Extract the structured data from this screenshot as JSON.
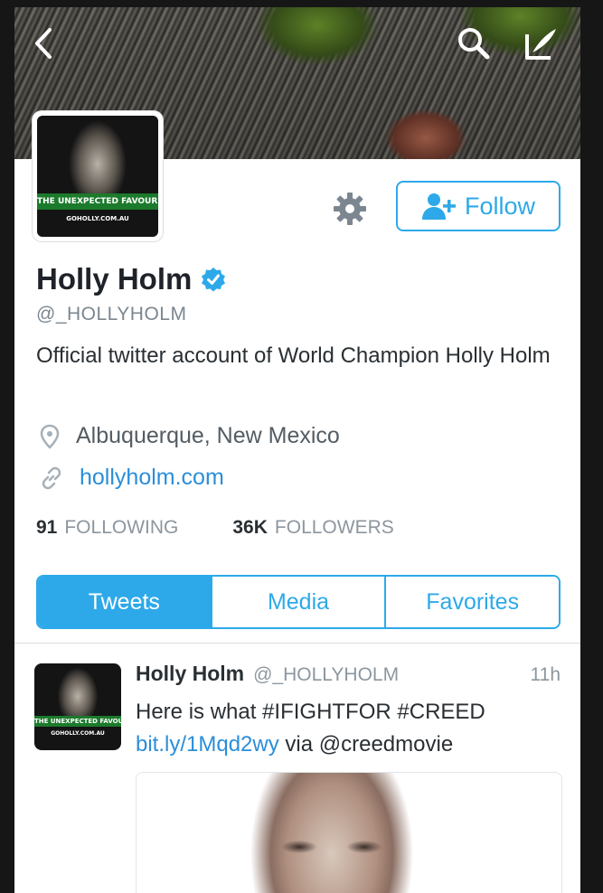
{
  "icons": {
    "back": "chevron-left-icon",
    "search": "search-icon",
    "compose": "compose-icon",
    "settings": "gear-icon",
    "follow": "add-person-icon",
    "verified": "verified-badge-icon",
    "location": "location-pin-icon",
    "link": "link-icon"
  },
  "colors": {
    "accent": "#2da9e9",
    "link": "#2b8ed9"
  },
  "avatar": {
    "tagline": "THE UNEXPECTED FAVOURITE",
    "site": "GOHOLLY.COM.AU"
  },
  "profile": {
    "follow_label": "Follow",
    "name": "Holly Holm",
    "handle": "@_HOLLYHOLM",
    "bio": "Official twitter account of World Champion Holly Holm",
    "location": "Albuquerque, New Mexico",
    "website": "hollyholm.com",
    "following_count": "91",
    "following_label": "FOLLOWING",
    "followers_count": "36K",
    "followers_label": "FOLLOWERS"
  },
  "tabs": [
    {
      "label": "Tweets",
      "active": true
    },
    {
      "label": "Media",
      "active": false
    },
    {
      "label": "Favorites",
      "active": false
    }
  ],
  "tweet": {
    "name": "Holly Holm",
    "handle": "@_HOLLYHOLM",
    "time": "11h",
    "text_line1": "Here is what #IFIGHTFOR #CREED",
    "link": "bit.ly/1Mqd2wy",
    "text_suffix": " via @creedmovie"
  }
}
